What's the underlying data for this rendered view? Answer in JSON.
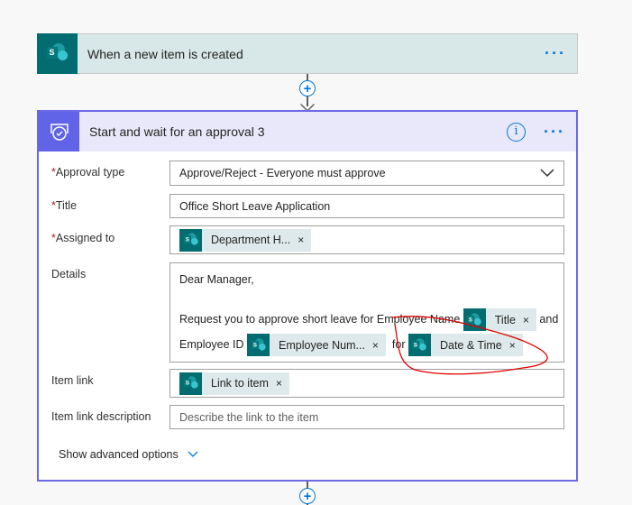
{
  "trigger": {
    "title": "When a new item is created",
    "icon": "sharepoint-icon",
    "menu": "···"
  },
  "connector": {
    "plus": "+"
  },
  "approval": {
    "title": "Start and wait for an approval 3",
    "icon": "approval-icon",
    "info": "i",
    "menu": "···",
    "accent": "#6b69e6",
    "fields": {
      "approval_type": {
        "label": "Approval type",
        "value": "Approve/Reject - Everyone must approve"
      },
      "title": {
        "label": "Title",
        "value": "Office Short Leave Application"
      },
      "assigned_to": {
        "label": "Assigned to",
        "token": "Department H..."
      },
      "details": {
        "label": "Details",
        "line1": "Dear Manager,",
        "line2": "Request you to  approve short leave for Employee Name",
        "token1": "Title",
        "and": "and",
        "line3": "Employee ID",
        "token2": "Employee Num...",
        "for": "for",
        "token3": "Date & Time"
      },
      "item_link": {
        "label": "Item link",
        "token": "Link to item"
      },
      "item_link_description": {
        "label": "Item link description",
        "placeholder": "Describe the link to the item"
      }
    },
    "advanced": "Show advanced options",
    "required_mark": "*",
    "remove": "×"
  }
}
